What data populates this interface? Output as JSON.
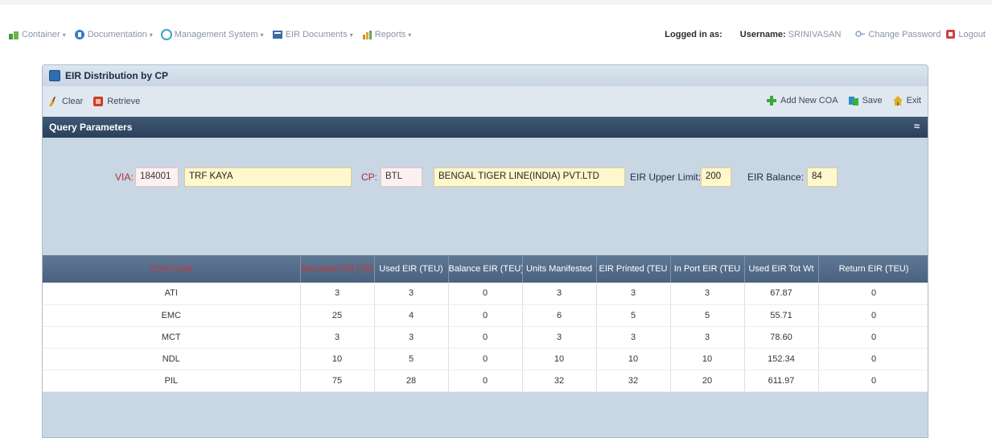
{
  "menu": {
    "items": [
      {
        "label": "Container",
        "icon": "container-icon",
        "color": "#4a9a3a"
      },
      {
        "label": "Documentation",
        "icon": "documentation-icon",
        "color": "#3a7ac8"
      },
      {
        "label": "Management System",
        "icon": "management-icon",
        "color": "#3aa3c8"
      },
      {
        "label": "EIR Documents",
        "icon": "eir-documents-icon",
        "color": "#3a6aa8"
      },
      {
        "label": "Reports",
        "icon": "reports-icon",
        "color": "#d48a2a"
      }
    ],
    "logged_in": "Logged in as:",
    "username_label": "Username:",
    "username": "SRINIVASAN",
    "change_password": "Change Password",
    "logout": "Logout"
  },
  "panel": {
    "title": "EIR Distribution by CP"
  },
  "toolbar": {
    "clear": "Clear",
    "retrieve": "Retrieve",
    "add_new_coa": "Add New COA",
    "save": "Save",
    "exit": "Exit"
  },
  "query": {
    "header": "Query Parameters",
    "collapse_glyph": "≈",
    "via_label": "VIA:",
    "via_code": "184001",
    "via_name": "TRF KAYA",
    "cp_label": "CP:",
    "cp_code": "BTL",
    "cp_name": "BENGAL TIGER LINE(INDIA) PVT.LTD",
    "upper_limit_label": "EIR Upper Limit:",
    "upper_limit": "200",
    "balance_label": "EIR Balance:",
    "balance": "84"
  },
  "grid": {
    "columns": [
      "COA Code",
      "Allocated EIR (TEU)",
      "Used EIR (TEU)",
      "Balance EIR (TEU)",
      "Units Manifested",
      "EIR Printed (TEU",
      "In Port EIR (TEU",
      "Used EIR Tot Wt",
      "Return EIR (TEU)"
    ],
    "rows": [
      [
        "ATI",
        "3",
        "3",
        "0",
        "3",
        "3",
        "3",
        "67.87",
        "0"
      ],
      [
        "EMC",
        "25",
        "4",
        "0",
        "6",
        "5",
        "5",
        "55.71",
        "0"
      ],
      [
        "MCT",
        "3",
        "3",
        "0",
        "3",
        "3",
        "3",
        "78.60",
        "0"
      ],
      [
        "NDL",
        "10",
        "5",
        "0",
        "10",
        "10",
        "10",
        "152.34",
        "0"
      ],
      [
        "PIL",
        "75",
        "28",
        "0",
        "32",
        "32",
        "20",
        "611.97",
        "0"
      ]
    ]
  },
  "colors": {
    "accent_red": "#e01010",
    "header_dark": "#2b405a",
    "field_yellow": "#fff8cc"
  }
}
